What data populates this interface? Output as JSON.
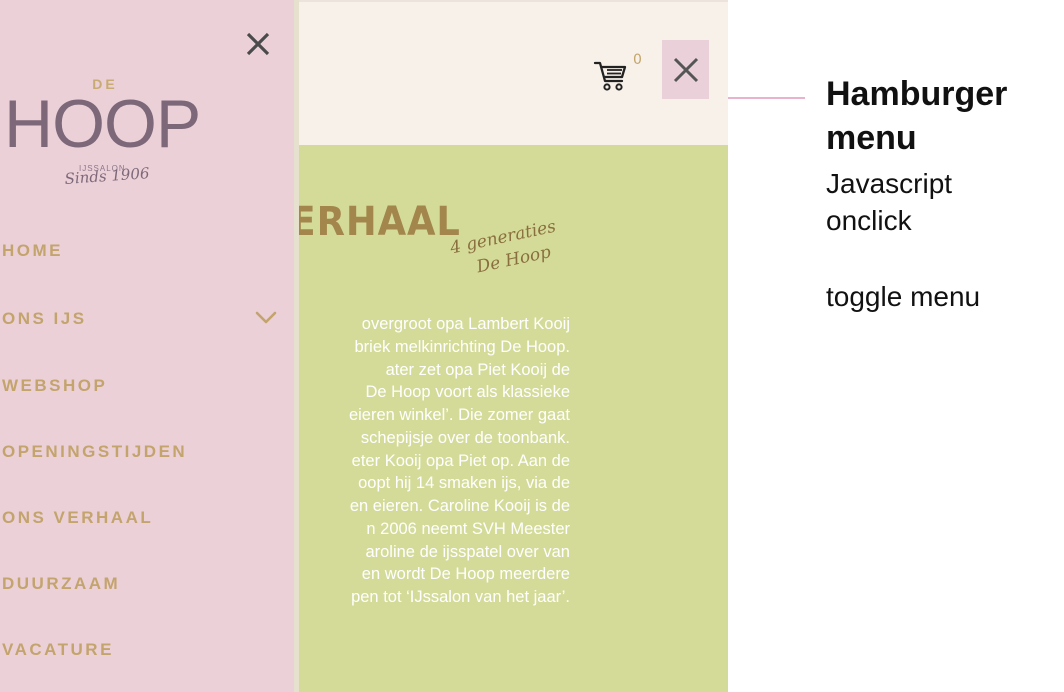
{
  "header": {
    "cart_icon": "shopping-cart-icon",
    "cart_count": "0",
    "close_icon": "close-icon",
    "background": "#f7f1ea",
    "close_button_color": "#ead0d8"
  },
  "story": {
    "title": "S VERHAAL",
    "tagline": [
      "4 generaties",
      "De Hoop"
    ],
    "lines": [
      "overgroot opa Lambert Kooij",
      "briek melkinrichting De Hoop.",
      "ater zet opa Piet Kooij de",
      "De Hoop voort als klassieke",
      "eieren winkel’. Die zomer gaat",
      "schepijsje over de toonbank.",
      "eter Kooij opa Piet op. Aan de",
      "oopt hij 14 smaken ijs, via de",
      "en eieren. Caroline Kooij is de",
      "n 2006 neemt SVH Meester",
      "aroline de ijsspatel over van",
      "en wordt De Hoop meerdere",
      "pen tot ‘IJssalon van het jaar’."
    ],
    "background": "#d4db99"
  },
  "sidemenu": {
    "close_icon": "close-icon",
    "logo": {
      "de": "DE",
      "hoop": "HOOP",
      "ijssalon": "IJSSALON",
      "sinds": "Sinds 1906"
    },
    "items": [
      {
        "label": "HOME"
      },
      {
        "label": "ONS IJS",
        "icon": "chevron-down-icon"
      },
      {
        "label": "WEBSHOP"
      },
      {
        "label": "OPENINGSTIJDEN"
      },
      {
        "label": "ONS VERHAAL"
      },
      {
        "label": "DUURZAAM"
      },
      {
        "label": "VACATURE"
      }
    ],
    "background": "#ebd0d8",
    "item_color": "#c3a46d"
  },
  "annotation": {
    "title": "Hamburger menu",
    "line1": "Javascript",
    "line2": "onclick",
    "line3": "toggle menu",
    "line_color": "#e9b2cd"
  }
}
